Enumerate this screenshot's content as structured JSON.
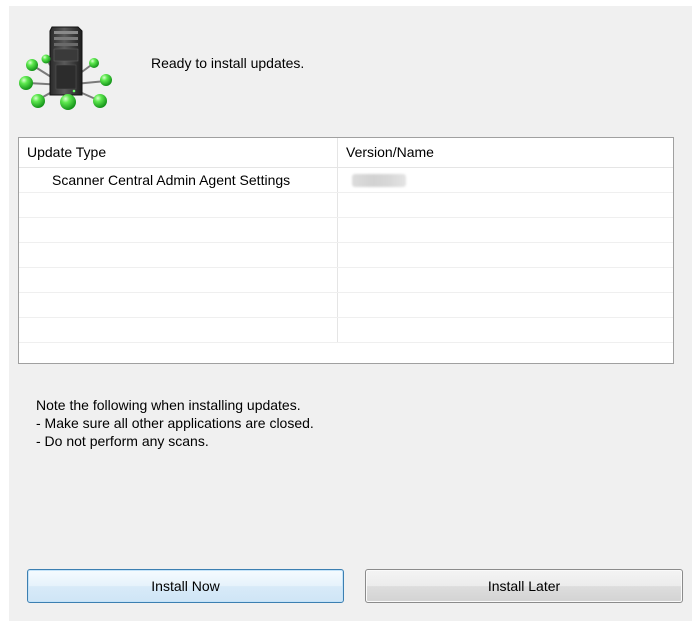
{
  "header": {
    "status_text": "Ready to install updates."
  },
  "icons": {
    "header_icon": "networked-server-icon"
  },
  "table": {
    "columns": [
      "Update Type",
      "Version/Name"
    ],
    "rows": [
      {
        "update_type": "Scanner Central Admin Agent Settings",
        "version_name": ""
      }
    ],
    "empty_rows": 6
  },
  "notes": {
    "heading": "Note the following when installing updates.",
    "items": [
      "- Make sure all other applications are closed.",
      "- Do not perform any scans."
    ]
  },
  "buttons": {
    "install_now": "Install Now",
    "install_later": "Install Later"
  },
  "colors": {
    "dialog_background": "#f0f0f0",
    "primary_button_border": "#3c7fb1",
    "node_green": "#3fd43a"
  }
}
